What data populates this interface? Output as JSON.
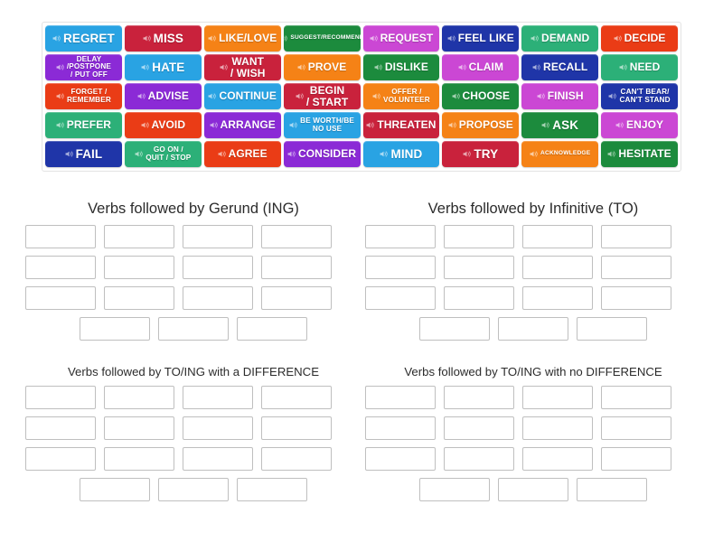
{
  "word_bank": {
    "name": "verb-word-bank",
    "icon": "speaker-icon",
    "rows": [
      [
        {
          "label": "REGRET",
          "color": "#29a3e3",
          "size": "sz-lg"
        },
        {
          "label": "MISS",
          "color": "#c9223c",
          "size": "sz-lg"
        },
        {
          "label": "LIKE/LOVE",
          "color": "#f58216",
          "size": "sz-md"
        },
        {
          "label": "SUGGEST/RECOMMEND",
          "color": "#1c8b3d",
          "size": "sz-xxs"
        },
        {
          "label": "REQUEST",
          "color": "#cb47d4",
          "size": "sz-md"
        },
        {
          "label": "FEEL LIKE",
          "color": "#1f35a8",
          "size": "sz-md"
        },
        {
          "label": "DEMAND",
          "color": "#2cb078",
          "size": "sz-md"
        },
        {
          "label": "DECIDE",
          "color": "#ea3c16",
          "size": "sz-md"
        }
      ],
      [
        {
          "label": "DELAY\n/POSTPONE\n/ PUT OFF",
          "color": "#8b2ad6",
          "size": "sz-xs"
        },
        {
          "label": "HATE",
          "color": "#29a3e3",
          "size": "sz-lg"
        },
        {
          "label": "WANT\n/ WISH",
          "color": "#c9223c",
          "size": "sz-md"
        },
        {
          "label": "PROVE",
          "color": "#f58216",
          "size": "sz-md"
        },
        {
          "label": "DISLIKE",
          "color": "#1c8b3d",
          "size": "sz-md"
        },
        {
          "label": "CLAIM",
          "color": "#cb47d4",
          "size": "sz-md"
        },
        {
          "label": "RECALL",
          "color": "#1f35a8",
          "size": "sz-md"
        },
        {
          "label": "NEED",
          "color": "#2cb078",
          "size": "sz-md"
        }
      ],
      [
        {
          "label": "FORGET /\nREMEMBER",
          "color": "#ea3c16",
          "size": "sz-xs"
        },
        {
          "label": "ADVISE",
          "color": "#8b2ad6",
          "size": "sz-md"
        },
        {
          "label": "CONTINUE",
          "color": "#29a3e3",
          "size": "sz-md"
        },
        {
          "label": "BEGIN\n/ START",
          "color": "#c9223c",
          "size": "sz-md"
        },
        {
          "label": "OFFER /\nVOLUNTEER",
          "color": "#f58216",
          "size": "sz-xs"
        },
        {
          "label": "CHOOSE",
          "color": "#1c8b3d",
          "size": "sz-md"
        },
        {
          "label": "FINISH",
          "color": "#cb47d4",
          "size": "sz-md"
        },
        {
          "label": "CAN'T BEAR/\nCAN'T STAND",
          "color": "#1f35a8",
          "size": "sz-xs"
        }
      ],
      [
        {
          "label": "PREFER",
          "color": "#2cb078",
          "size": "sz-md"
        },
        {
          "label": "AVOID",
          "color": "#ea3c16",
          "size": "sz-md"
        },
        {
          "label": "ARRANGE",
          "color": "#8b2ad6",
          "size": "sz-md"
        },
        {
          "label": "BE WORTH/BE\nNO USE",
          "color": "#29a3e3",
          "size": "sz-xs"
        },
        {
          "label": "THREATEN",
          "color": "#c9223c",
          "size": "sz-md"
        },
        {
          "label": "PROPOSE",
          "color": "#f58216",
          "size": "sz-md"
        },
        {
          "label": "ASK",
          "color": "#1c8b3d",
          "size": "sz-lg"
        },
        {
          "label": "ENJOY",
          "color": "#cb47d4",
          "size": "sz-md"
        }
      ],
      [
        {
          "label": "FAIL",
          "color": "#1f35a8",
          "size": "sz-lg"
        },
        {
          "label": "GO ON /\nQUIT / STOP",
          "color": "#2cb078",
          "size": "sz-xs"
        },
        {
          "label": "AGREE",
          "color": "#ea3c16",
          "size": "sz-md"
        },
        {
          "label": "CONSIDER",
          "color": "#8b2ad6",
          "size": "sz-md"
        },
        {
          "label": "MIND",
          "color": "#29a3e3",
          "size": "sz-lg"
        },
        {
          "label": "TRY",
          "color": "#c9223c",
          "size": "sz-lg"
        },
        {
          "label": "ACKNOWLEDGE",
          "color": "#f58216",
          "size": "sz-xxs"
        },
        {
          "label": "HESITATE",
          "color": "#1c8b3d",
          "size": "sz-md"
        }
      ]
    ]
  },
  "categories": [
    {
      "id": "gerund",
      "title": "Verbs followed by Gerund (ING)",
      "title_size": "title-lg",
      "rows": [
        4,
        4,
        4,
        3
      ]
    },
    {
      "id": "infinitive",
      "title": "Verbs followed by Infinitive (TO)",
      "title_size": "title-lg",
      "rows": [
        4,
        4,
        4,
        3
      ]
    },
    {
      "id": "to-ing-difference",
      "title": "Verbs followed by TO/ING with a DIFFERENCE",
      "title_size": "title-sm",
      "rows": [
        4,
        4,
        4,
        3
      ]
    },
    {
      "id": "to-ing-no-difference",
      "title": "Verbs followed by TO/ING with no DIFFERENCE",
      "title_size": "title-sm",
      "rows": [
        4,
        4,
        4,
        3
      ]
    }
  ]
}
